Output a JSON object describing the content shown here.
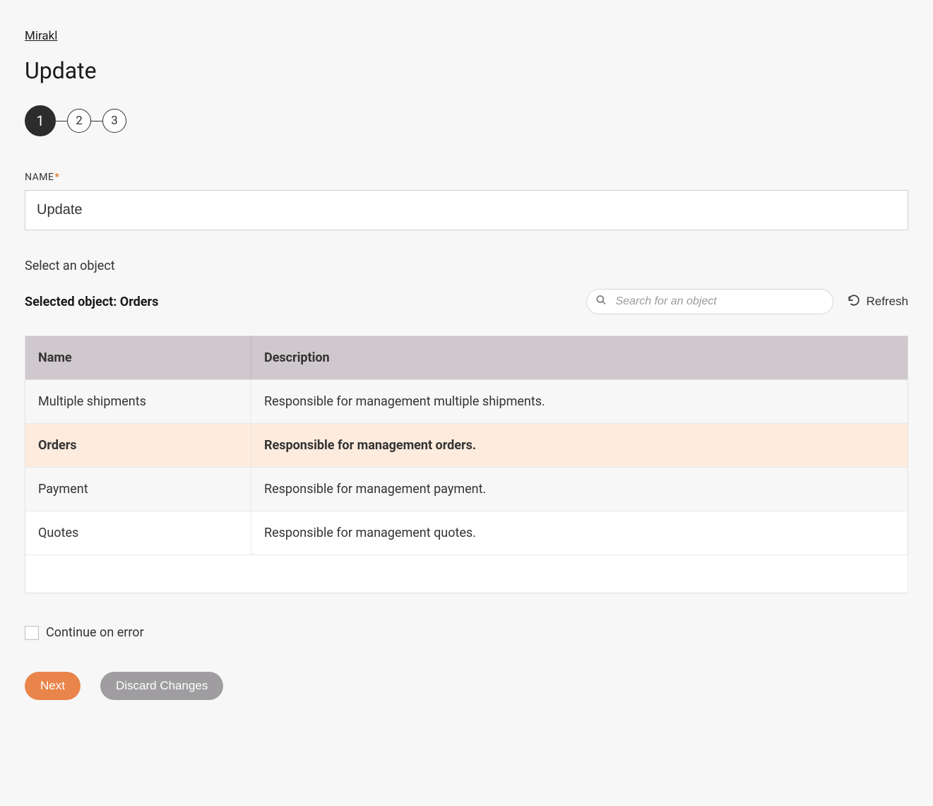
{
  "breadcrumb": {
    "label": "Mirakl"
  },
  "page": {
    "title": "Update"
  },
  "stepper": {
    "steps": [
      "1",
      "2",
      "3"
    ],
    "active_index": 0
  },
  "name_field": {
    "label": "NAME",
    "required_mark": "*",
    "value": "Update"
  },
  "object_section": {
    "heading": "Select an object",
    "selected_prefix": "Selected object: ",
    "selected_value": "Orders",
    "search_placeholder": "Search for an object",
    "refresh_label": "Refresh"
  },
  "table": {
    "headers": {
      "name": "Name",
      "description": "Description"
    },
    "rows": [
      {
        "name": "Multiple shipments",
        "description": "Responsible for management multiple shipments.",
        "selected": false
      },
      {
        "name": "Orders",
        "description": "Responsible for management orders.",
        "selected": true
      },
      {
        "name": "Payment",
        "description": "Responsible for management payment.",
        "selected": false
      },
      {
        "name": "Quotes",
        "description": "Responsible for management quotes.",
        "selected": false
      }
    ]
  },
  "continue_on_error": {
    "label": "Continue on error",
    "checked": false
  },
  "actions": {
    "next": "Next",
    "discard": "Discard Changes"
  }
}
